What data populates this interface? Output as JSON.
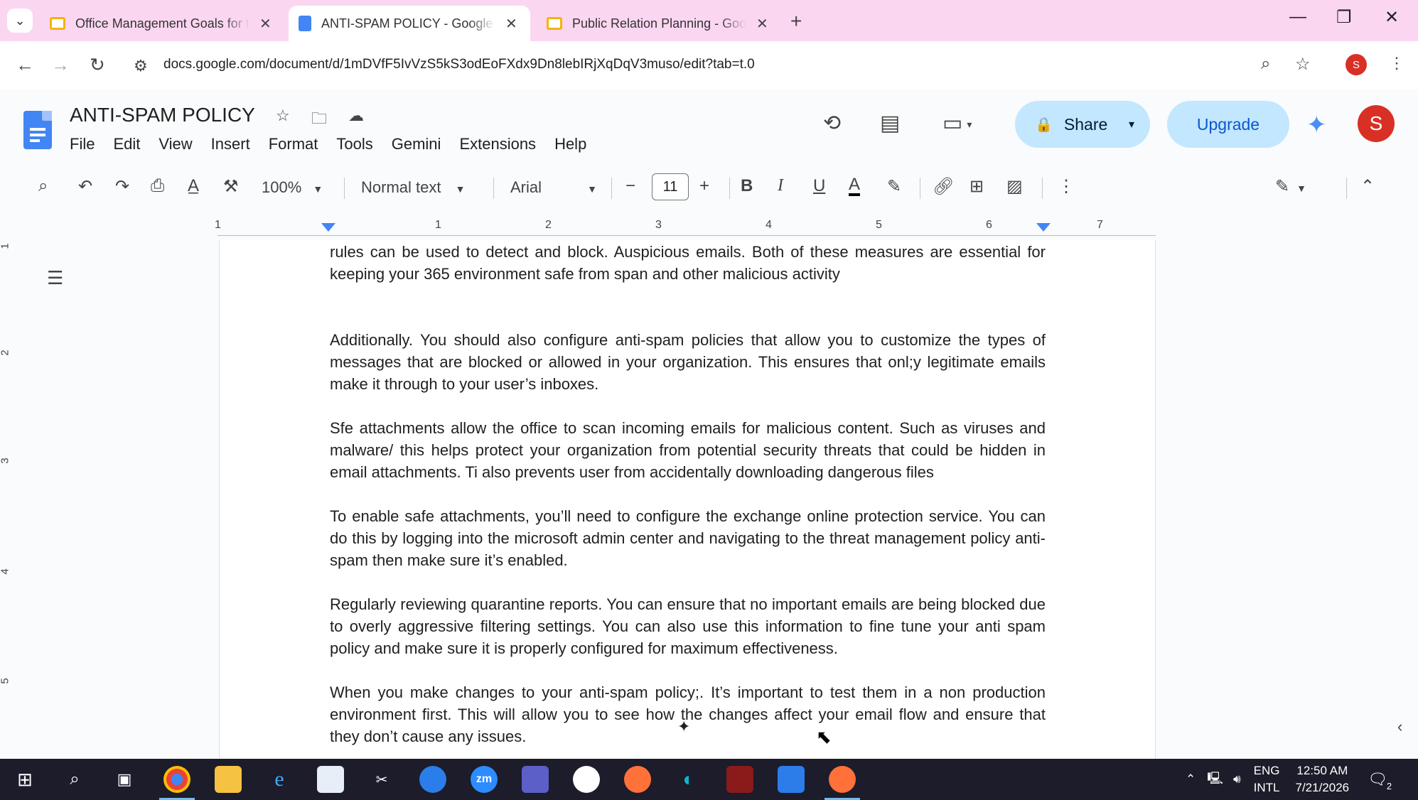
{
  "browser": {
    "tabs": [
      {
        "title": "Office Management Goals for t",
        "type": "slides",
        "active": false
      },
      {
        "title": "ANTI-SPAM POLICY - Google D",
        "type": "docs",
        "active": true
      },
      {
        "title": "Public Relation Planning - Goo",
        "type": "slides",
        "active": false
      }
    ],
    "url": "docs.google.com/document/d/1mDVfF5IvVzS5kS3odEoFXdx9Dn8lebIRjXqDqV3muso/edit?tab=t.0",
    "profile_initial": "S"
  },
  "docs": {
    "title": "ANTI-SPAM POLICY",
    "menu": [
      "File",
      "Edit",
      "View",
      "Insert",
      "Format",
      "Tools",
      "Gemini",
      "Extensions",
      "Help"
    ],
    "share_label": "Share",
    "upgrade_label": "Upgrade",
    "avatar_initial": "S",
    "toolbar": {
      "zoom": "100%",
      "style": "Normal text",
      "font": "Arial",
      "font_size": "11"
    },
    "ruler_numbers": [
      "1",
      "1",
      "2",
      "3",
      "4",
      "5",
      "6",
      "7"
    ],
    "vruler_numbers": [
      "1",
      "2",
      "3",
      "4",
      "5"
    ]
  },
  "document": {
    "paragraphs": [
      "rules can be used to detect and block. Auspicious emails. Both of these measures are essential for keeping your 365 environment safe from span and other malicious activity",
      "Additionally. You should also configure anti-spam policies that allow you to customize the types of messages that are blocked or allowed in your organization. This ensures that onl;y legitimate emails make it through to your user’s inboxes.",
      "Sfe attachments allow the office to scan incoming  emails for malicious content. Such as viruses and malware/ this helps protect your organization from potential security threats that could be hidden in email attachments. Ti also prevents user from accidentally downloading dangerous files",
      "To enable safe attachments, you’ll need to configure the exchange online protection service. You can do this by logging into the microsoft admin center and navigating to the threat management policy anti-spam then make sure it’s enabled.",
      "Regularly reviewing quarantine reports. You can ensure that no important emails are being blocked due to  overly aggressive filtering settings. You can also use this information to fine tune your anti spam policy and make sure it is properly configured for maximum effectiveness.",
      "When you make changes to your anti-spam policy;. It’s important to test them in a non production environment first. This will allow you to see how the changes affect your email flow and ensure that they don’t cause any issues."
    ]
  },
  "taskbar": {
    "lang_top": "ENG",
    "lang_bottom": "INTL",
    "time": "12:50 AM",
    "date": "7/21/2026",
    "notification_count": "2"
  },
  "colors": {
    "tabstrip": "#fbd6f1",
    "share_bg": "#c2e7ff",
    "docs_blue": "#4285f4",
    "avatar": "#d93025",
    "taskbar": "#1c1c2b"
  }
}
